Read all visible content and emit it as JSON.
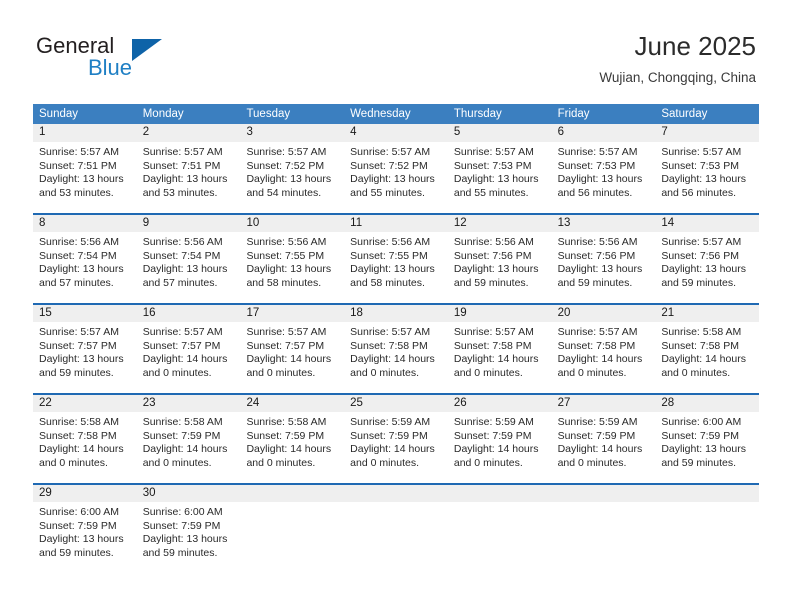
{
  "brand": {
    "name_part1": "General",
    "name_part2": "Blue",
    "accent_color": "#0e63a8",
    "blue_text_color": "#1f7fc4"
  },
  "header": {
    "title": "June 2025",
    "subtitle": "Wujian, Chongqing, China"
  },
  "theme": {
    "header_row_bg": "#3b7fc0",
    "divider_color": "#1f69b3",
    "daynum_band_bg": "#efefef",
    "cell_bg": "#ffffff"
  },
  "weekdays": [
    "Sunday",
    "Monday",
    "Tuesday",
    "Wednesday",
    "Thursday",
    "Friday",
    "Saturday"
  ],
  "weeks": [
    {
      "days": [
        {
          "num": "1",
          "l1": "Sunrise: 5:57 AM",
          "l2": "Sunset: 7:51 PM",
          "l3": "Daylight: 13 hours",
          "l4": "and 53 minutes."
        },
        {
          "num": "2",
          "l1": "Sunrise: 5:57 AM",
          "l2": "Sunset: 7:51 PM",
          "l3": "Daylight: 13 hours",
          "l4": "and 53 minutes."
        },
        {
          "num": "3",
          "l1": "Sunrise: 5:57 AM",
          "l2": "Sunset: 7:52 PM",
          "l3": "Daylight: 13 hours",
          "l4": "and 54 minutes."
        },
        {
          "num": "4",
          "l1": "Sunrise: 5:57 AM",
          "l2": "Sunset: 7:52 PM",
          "l3": "Daylight: 13 hours",
          "l4": "and 55 minutes."
        },
        {
          "num": "5",
          "l1": "Sunrise: 5:57 AM",
          "l2": "Sunset: 7:53 PM",
          "l3": "Daylight: 13 hours",
          "l4": "and 55 minutes."
        },
        {
          "num": "6",
          "l1": "Sunrise: 5:57 AM",
          "l2": "Sunset: 7:53 PM",
          "l3": "Daylight: 13 hours",
          "l4": "and 56 minutes."
        },
        {
          "num": "7",
          "l1": "Sunrise: 5:57 AM",
          "l2": "Sunset: 7:53 PM",
          "l3": "Daylight: 13 hours",
          "l4": "and 56 minutes."
        }
      ]
    },
    {
      "days": [
        {
          "num": "8",
          "l1": "Sunrise: 5:56 AM",
          "l2": "Sunset: 7:54 PM",
          "l3": "Daylight: 13 hours",
          "l4": "and 57 minutes."
        },
        {
          "num": "9",
          "l1": "Sunrise: 5:56 AM",
          "l2": "Sunset: 7:54 PM",
          "l3": "Daylight: 13 hours",
          "l4": "and 57 minutes."
        },
        {
          "num": "10",
          "l1": "Sunrise: 5:56 AM",
          "l2": "Sunset: 7:55 PM",
          "l3": "Daylight: 13 hours",
          "l4": "and 58 minutes."
        },
        {
          "num": "11",
          "l1": "Sunrise: 5:56 AM",
          "l2": "Sunset: 7:55 PM",
          "l3": "Daylight: 13 hours",
          "l4": "and 58 minutes."
        },
        {
          "num": "12",
          "l1": "Sunrise: 5:56 AM",
          "l2": "Sunset: 7:56 PM",
          "l3": "Daylight: 13 hours",
          "l4": "and 59 minutes."
        },
        {
          "num": "13",
          "l1": "Sunrise: 5:56 AM",
          "l2": "Sunset: 7:56 PM",
          "l3": "Daylight: 13 hours",
          "l4": "and 59 minutes."
        },
        {
          "num": "14",
          "l1": "Sunrise: 5:57 AM",
          "l2": "Sunset: 7:56 PM",
          "l3": "Daylight: 13 hours",
          "l4": "and 59 minutes."
        }
      ]
    },
    {
      "days": [
        {
          "num": "15",
          "l1": "Sunrise: 5:57 AM",
          "l2": "Sunset: 7:57 PM",
          "l3": "Daylight: 13 hours",
          "l4": "and 59 minutes."
        },
        {
          "num": "16",
          "l1": "Sunrise: 5:57 AM",
          "l2": "Sunset: 7:57 PM",
          "l3": "Daylight: 14 hours",
          "l4": "and 0 minutes."
        },
        {
          "num": "17",
          "l1": "Sunrise: 5:57 AM",
          "l2": "Sunset: 7:57 PM",
          "l3": "Daylight: 14 hours",
          "l4": "and 0 minutes."
        },
        {
          "num": "18",
          "l1": "Sunrise: 5:57 AM",
          "l2": "Sunset: 7:58 PM",
          "l3": "Daylight: 14 hours",
          "l4": "and 0 minutes."
        },
        {
          "num": "19",
          "l1": "Sunrise: 5:57 AM",
          "l2": "Sunset: 7:58 PM",
          "l3": "Daylight: 14 hours",
          "l4": "and 0 minutes."
        },
        {
          "num": "20",
          "l1": "Sunrise: 5:57 AM",
          "l2": "Sunset: 7:58 PM",
          "l3": "Daylight: 14 hours",
          "l4": "and 0 minutes."
        },
        {
          "num": "21",
          "l1": "Sunrise: 5:58 AM",
          "l2": "Sunset: 7:58 PM",
          "l3": "Daylight: 14 hours",
          "l4": "and 0 minutes."
        }
      ]
    },
    {
      "days": [
        {
          "num": "22",
          "l1": "Sunrise: 5:58 AM",
          "l2": "Sunset: 7:58 PM",
          "l3": "Daylight: 14 hours",
          "l4": "and 0 minutes."
        },
        {
          "num": "23",
          "l1": "Sunrise: 5:58 AM",
          "l2": "Sunset: 7:59 PM",
          "l3": "Daylight: 14 hours",
          "l4": "and 0 minutes."
        },
        {
          "num": "24",
          "l1": "Sunrise: 5:58 AM",
          "l2": "Sunset: 7:59 PM",
          "l3": "Daylight: 14 hours",
          "l4": "and 0 minutes."
        },
        {
          "num": "25",
          "l1": "Sunrise: 5:59 AM",
          "l2": "Sunset: 7:59 PM",
          "l3": "Daylight: 14 hours",
          "l4": "and 0 minutes."
        },
        {
          "num": "26",
          "l1": "Sunrise: 5:59 AM",
          "l2": "Sunset: 7:59 PM",
          "l3": "Daylight: 14 hours",
          "l4": "and 0 minutes."
        },
        {
          "num": "27",
          "l1": "Sunrise: 5:59 AM",
          "l2": "Sunset: 7:59 PM",
          "l3": "Daylight: 14 hours",
          "l4": "and 0 minutes."
        },
        {
          "num": "28",
          "l1": "Sunrise: 6:00 AM",
          "l2": "Sunset: 7:59 PM",
          "l3": "Daylight: 13 hours",
          "l4": "and 59 minutes."
        }
      ]
    },
    {
      "days": [
        {
          "num": "29",
          "l1": "Sunrise: 6:00 AM",
          "l2": "Sunset: 7:59 PM",
          "l3": "Daylight: 13 hours",
          "l4": "and 59 minutes."
        },
        {
          "num": "30",
          "l1": "Sunrise: 6:00 AM",
          "l2": "Sunset: 7:59 PM",
          "l3": "Daylight: 13 hours",
          "l4": "and 59 minutes."
        },
        {
          "num": "",
          "l1": "",
          "l2": "",
          "l3": "",
          "l4": ""
        },
        {
          "num": "",
          "l1": "",
          "l2": "",
          "l3": "",
          "l4": ""
        },
        {
          "num": "",
          "l1": "",
          "l2": "",
          "l3": "",
          "l4": ""
        },
        {
          "num": "",
          "l1": "",
          "l2": "",
          "l3": "",
          "l4": ""
        },
        {
          "num": "",
          "l1": "",
          "l2": "",
          "l3": "",
          "l4": ""
        }
      ]
    }
  ]
}
